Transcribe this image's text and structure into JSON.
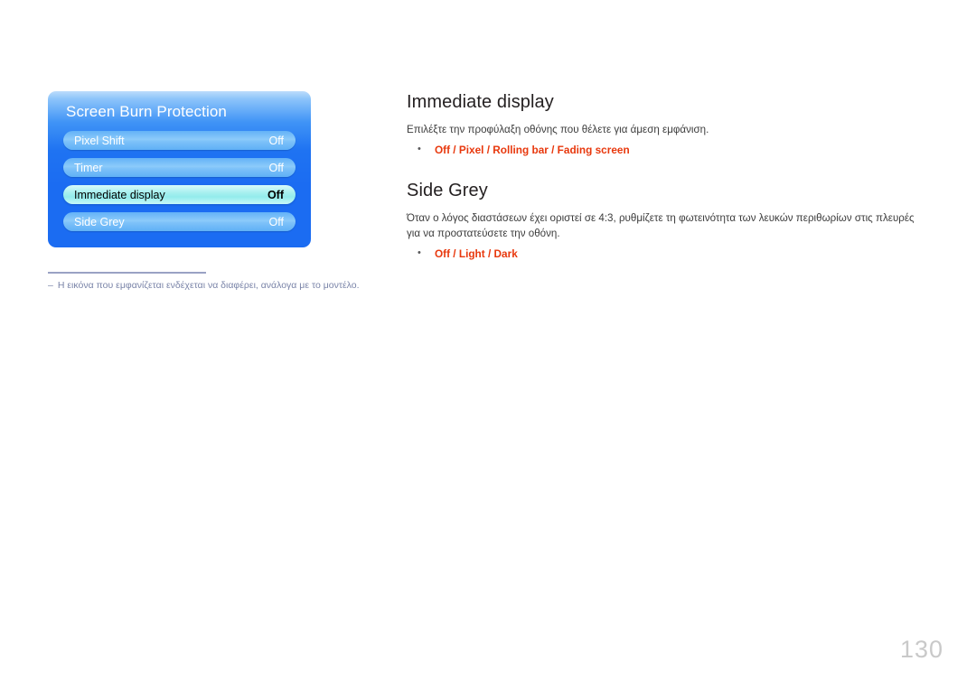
{
  "osd": {
    "title": "Screen Burn Protection",
    "rows": [
      {
        "label": "Pixel Shift",
        "value": "Off",
        "selected": false
      },
      {
        "label": "Timer",
        "value": "Off",
        "selected": false
      },
      {
        "label": "Immediate display",
        "value": "Off",
        "selected": true
      },
      {
        "label": "Side Grey",
        "value": "Off",
        "selected": false
      }
    ]
  },
  "footnote": {
    "dash": "–",
    "text": "Η εικόνα που εμφανίζεται ενδέχεται να διαφέρει, ανάλογα με το μοντέλο."
  },
  "sections": {
    "immediate_display": {
      "heading": "Immediate display",
      "body": "Επιλέξτε την προφύλαξη οθόνης που θέλετε για άμεση εμφάνιση.",
      "options": "Off / Pixel / Rolling bar / Fading screen"
    },
    "side_grey": {
      "heading": "Side Grey",
      "body": "Όταν ο λόγος διαστάσεων έχει οριστεί σε 4:3, ρυθμίζετε τη φωτεινότητα των λευκών περιθωρίων στις πλευρές για να προστατεύσετε την οθόνη.",
      "options": "Off / Light / Dark"
    }
  },
  "page_number": "130",
  "colors": {
    "accent_red": "#e8380d",
    "osd_blue": "#1b6cf2",
    "osd_row_blue": "#8ccbfa",
    "osd_selected_cyan": "#93ecec",
    "footnote_grey": "#7a84a8",
    "page_number_grey": "#c9c9c9",
    "heading_black": "#231f20"
  }
}
